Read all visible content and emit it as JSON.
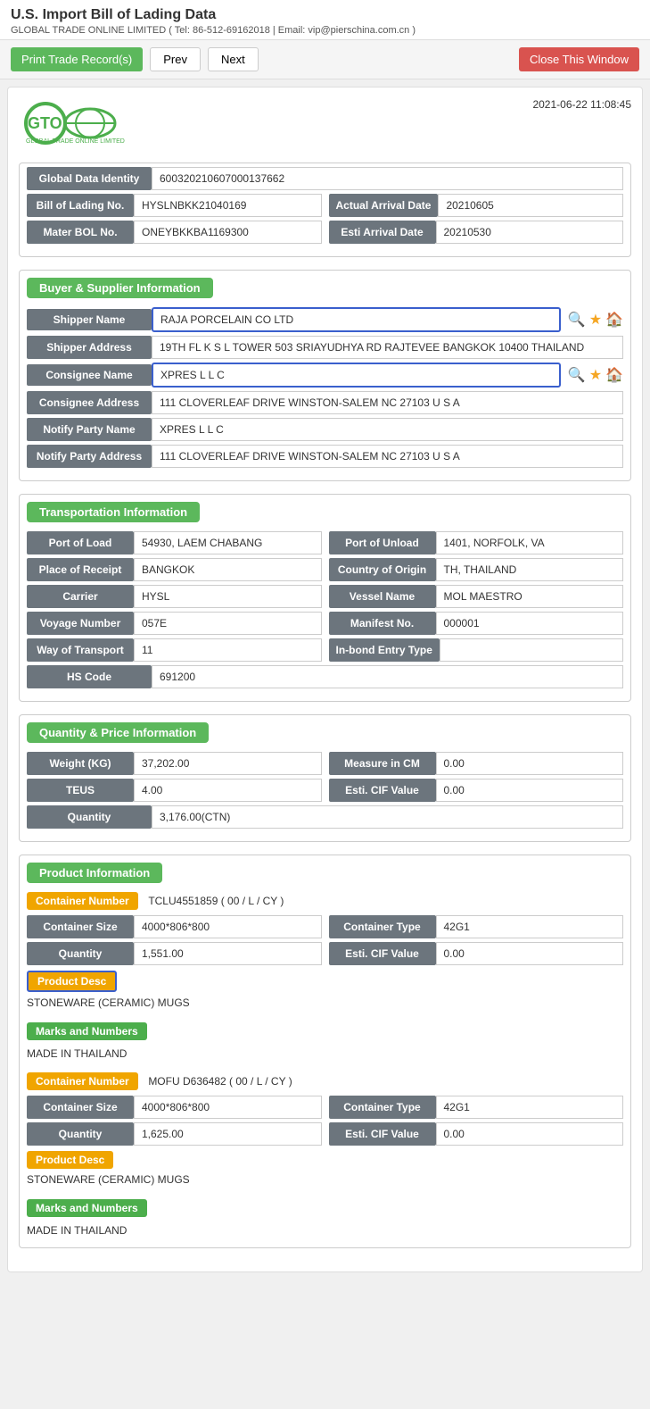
{
  "header": {
    "title": "U.S. Import Bill of Lading Data",
    "subtitle": "GLOBAL TRADE ONLINE LIMITED ( Tel: 86-512-69162018 | Email: vip@pierschina.com.cn )",
    "timestamp": "2021-06-22 11:08:45"
  },
  "toolbar": {
    "print_label": "Print Trade Record(s)",
    "prev_label": "Prev",
    "next_label": "Next",
    "close_label": "Close This Window"
  },
  "doc": {
    "global_data_identity_label": "Global Data Identity",
    "global_data_identity_value": "600320210607000137662",
    "bill_of_lading_label": "Bill of Lading No.",
    "bill_of_lading_value": "HYSLNBKK21040169",
    "actual_arrival_label": "Actual Arrival Date",
    "actual_arrival_value": "20210605",
    "mater_bol_label": "Mater BOL No.",
    "mater_bol_value": "ONEYBKKBA1169300",
    "esti_arrival_label": "Esti Arrival Date",
    "esti_arrival_value": "20210530"
  },
  "buyer_supplier": {
    "section_title": "Buyer & Supplier Information",
    "shipper_name_label": "Shipper Name",
    "shipper_name_value": "RAJA PORCELAIN CO LTD",
    "shipper_address_label": "Shipper Address",
    "shipper_address_value": "19TH FL K S L TOWER 503 SRIAYUDHYA RD RAJTEVEE BANGKOK 10400 THAILAND",
    "consignee_name_label": "Consignee Name",
    "consignee_name_value": "XPRES L L C",
    "consignee_address_label": "Consignee Address",
    "consignee_address_value": "111 CLOVERLEAF DRIVE WINSTON-SALEM NC 27103 U S A",
    "notify_party_name_label": "Notify Party Name",
    "notify_party_name_value": "XPRES L L C",
    "notify_party_address_label": "Notify Party Address",
    "notify_party_address_value": "111 CLOVERLEAF DRIVE WINSTON-SALEM NC 27103 U S A"
  },
  "transportation": {
    "section_title": "Transportation Information",
    "port_of_load_label": "Port of Load",
    "port_of_load_value": "54930, LAEM CHABANG",
    "port_of_unload_label": "Port of Unload",
    "port_of_unload_value": "1401, NORFOLK, VA",
    "place_of_receipt_label": "Place of Receipt",
    "place_of_receipt_value": "BANGKOK",
    "country_of_origin_label": "Country of Origin",
    "country_of_origin_value": "TH, THAILAND",
    "carrier_label": "Carrier",
    "carrier_value": "HYSL",
    "vessel_name_label": "Vessel Name",
    "vessel_name_value": "MOL MAESTRO",
    "voyage_number_label": "Voyage Number",
    "voyage_number_value": "057E",
    "manifest_no_label": "Manifest No.",
    "manifest_no_value": "000001",
    "way_of_transport_label": "Way of Transport",
    "way_of_transport_value": "11",
    "inbond_entry_label": "In-bond Entry Type",
    "inbond_entry_value": "",
    "hs_code_label": "HS Code",
    "hs_code_value": "691200"
  },
  "quantity_price": {
    "section_title": "Quantity & Price Information",
    "weight_label": "Weight (KG)",
    "weight_value": "37,202.00",
    "measure_label": "Measure in CM",
    "measure_value": "0.00",
    "teus_label": "TEUS",
    "teus_value": "4.00",
    "esti_cif_label": "Esti. CIF Value",
    "esti_cif_value": "0.00",
    "quantity_label": "Quantity",
    "quantity_value": "3,176.00(CTN)"
  },
  "product_info": {
    "section_title": "Product Information",
    "containers": [
      {
        "container_number_label": "Container Number",
        "container_number_value": "TCLU4551859 ( 00 / L / CY )",
        "container_size_label": "Container Size",
        "container_size_value": "4000*806*800",
        "container_type_label": "Container Type",
        "container_type_value": "42G1",
        "quantity_label": "Quantity",
        "quantity_value": "1,551.00",
        "esti_cif_label": "Esti. CIF Value",
        "esti_cif_value": "0.00",
        "product_desc_label": "Product Desc",
        "product_desc_value": "STONEWARE (CERAMIC) MUGS",
        "marks_label": "Marks and Numbers",
        "marks_value": "MADE IN THAILAND"
      },
      {
        "container_number_label": "Container Number",
        "container_number_value": "MOFU D636482 ( 00 / L / CY )",
        "container_size_label": "Container Size",
        "container_size_value": "4000*806*800",
        "container_type_label": "Container Type",
        "container_type_value": "42G1",
        "quantity_label": "Quantity",
        "quantity_value": "1,625.00",
        "esti_cif_label": "Esti. CIF Value",
        "esti_cif_value": "0.00",
        "product_desc_label": "Product Desc",
        "product_desc_value": "STONEWARE (CERAMIC) MUGS",
        "marks_label": "Marks and Numbers",
        "marks_value": "MADE IN THAILAND"
      }
    ]
  }
}
